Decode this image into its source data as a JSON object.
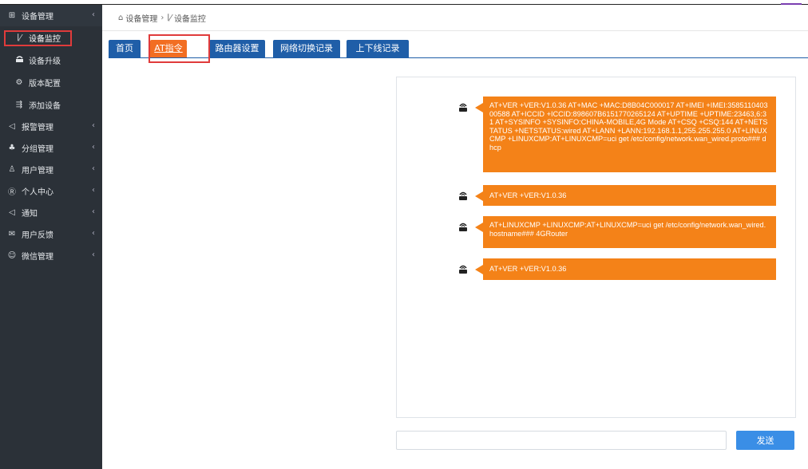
{
  "sidebar": {
    "items": [
      {
        "label": "设备管理",
        "icon": "grid-icon",
        "type": "header",
        "chevron": "‹"
      },
      {
        "label": "设备监控",
        "icon": "chart-icon",
        "type": "sub",
        "active": true
      },
      {
        "label": "设备升级",
        "icon": "router-icon",
        "type": "sub"
      },
      {
        "label": "版本配置",
        "icon": "gear-circle-icon",
        "type": "sub"
      },
      {
        "label": "添加设备",
        "icon": "add-device-icon",
        "type": "sub"
      },
      {
        "label": "报警管理",
        "icon": "speaker-icon",
        "type": "item",
        "chevron": "‹"
      },
      {
        "label": "分组管理",
        "icon": "group-icon",
        "type": "item",
        "chevron": "‹"
      },
      {
        "label": "用户管理",
        "icon": "users-icon",
        "type": "item",
        "chevron": "‹"
      },
      {
        "label": "个人中心",
        "icon": "profile-icon",
        "type": "item",
        "chevron": "‹"
      },
      {
        "label": "通知",
        "icon": "speaker-icon",
        "type": "item",
        "chevron": "‹"
      },
      {
        "label": "用户反馈",
        "icon": "feedback-icon",
        "type": "item",
        "chevron": "‹"
      },
      {
        "label": "微信管理",
        "icon": "wechat-icon",
        "type": "item",
        "chevron": "‹"
      }
    ]
  },
  "breadcrumb": {
    "home_icon": "home-icon",
    "parent": "设备管理",
    "separator": "›",
    "current_icon": "chart-icon",
    "current": "设备监控"
  },
  "tabs": [
    {
      "label": "首页"
    },
    {
      "label": "AT指令",
      "active": true
    },
    {
      "label": "路由器设置"
    },
    {
      "label": "网络切换记录"
    },
    {
      "label": "上下线记录"
    }
  ],
  "messages": [
    {
      "text": "AT+VER +VER:V1.0.36 AT+MAC +MAC:D8B04C000017 AT+IMEI +IMEI:358511040300588 AT+ICCID +ICCID:898607B6151770265124 AT+UPTIME +UPTIME:23463,6:31 AT+SYSINFO +SYSINFO:CHINA-MOBILE,4G Mode AT+CSQ +CSQ:144 AT+NETSTATUS +NETSTATUS:wired AT+LANN +LANN:192.168.1.1,255.255.255.0 AT+LINUXCMP +LINUXCMP:AT+LINUXCMP=uci get /etc/config/network.wan_wired.proto### dhcp"
    },
    {
      "text": "AT+VER +VER:V1.0.36"
    },
    {
      "text": "AT+LINUXCMP +LINUXCMP:AT+LINUXCMP=uci get /etc/config/network.wan_wired.hostname### 4GRouter"
    },
    {
      "text": "AT+VER +VER:V1.0.36"
    }
  ],
  "composer": {
    "value": "",
    "placeholder": "",
    "send_label": "发送"
  },
  "colors": {
    "sidebar_bg": "#2b3138",
    "tab_blue": "#1f5ea8",
    "tab_active": "#f26e22",
    "bubble": "#f48218",
    "send_button": "#3a8ee6",
    "highlight": "#e03b3b"
  }
}
